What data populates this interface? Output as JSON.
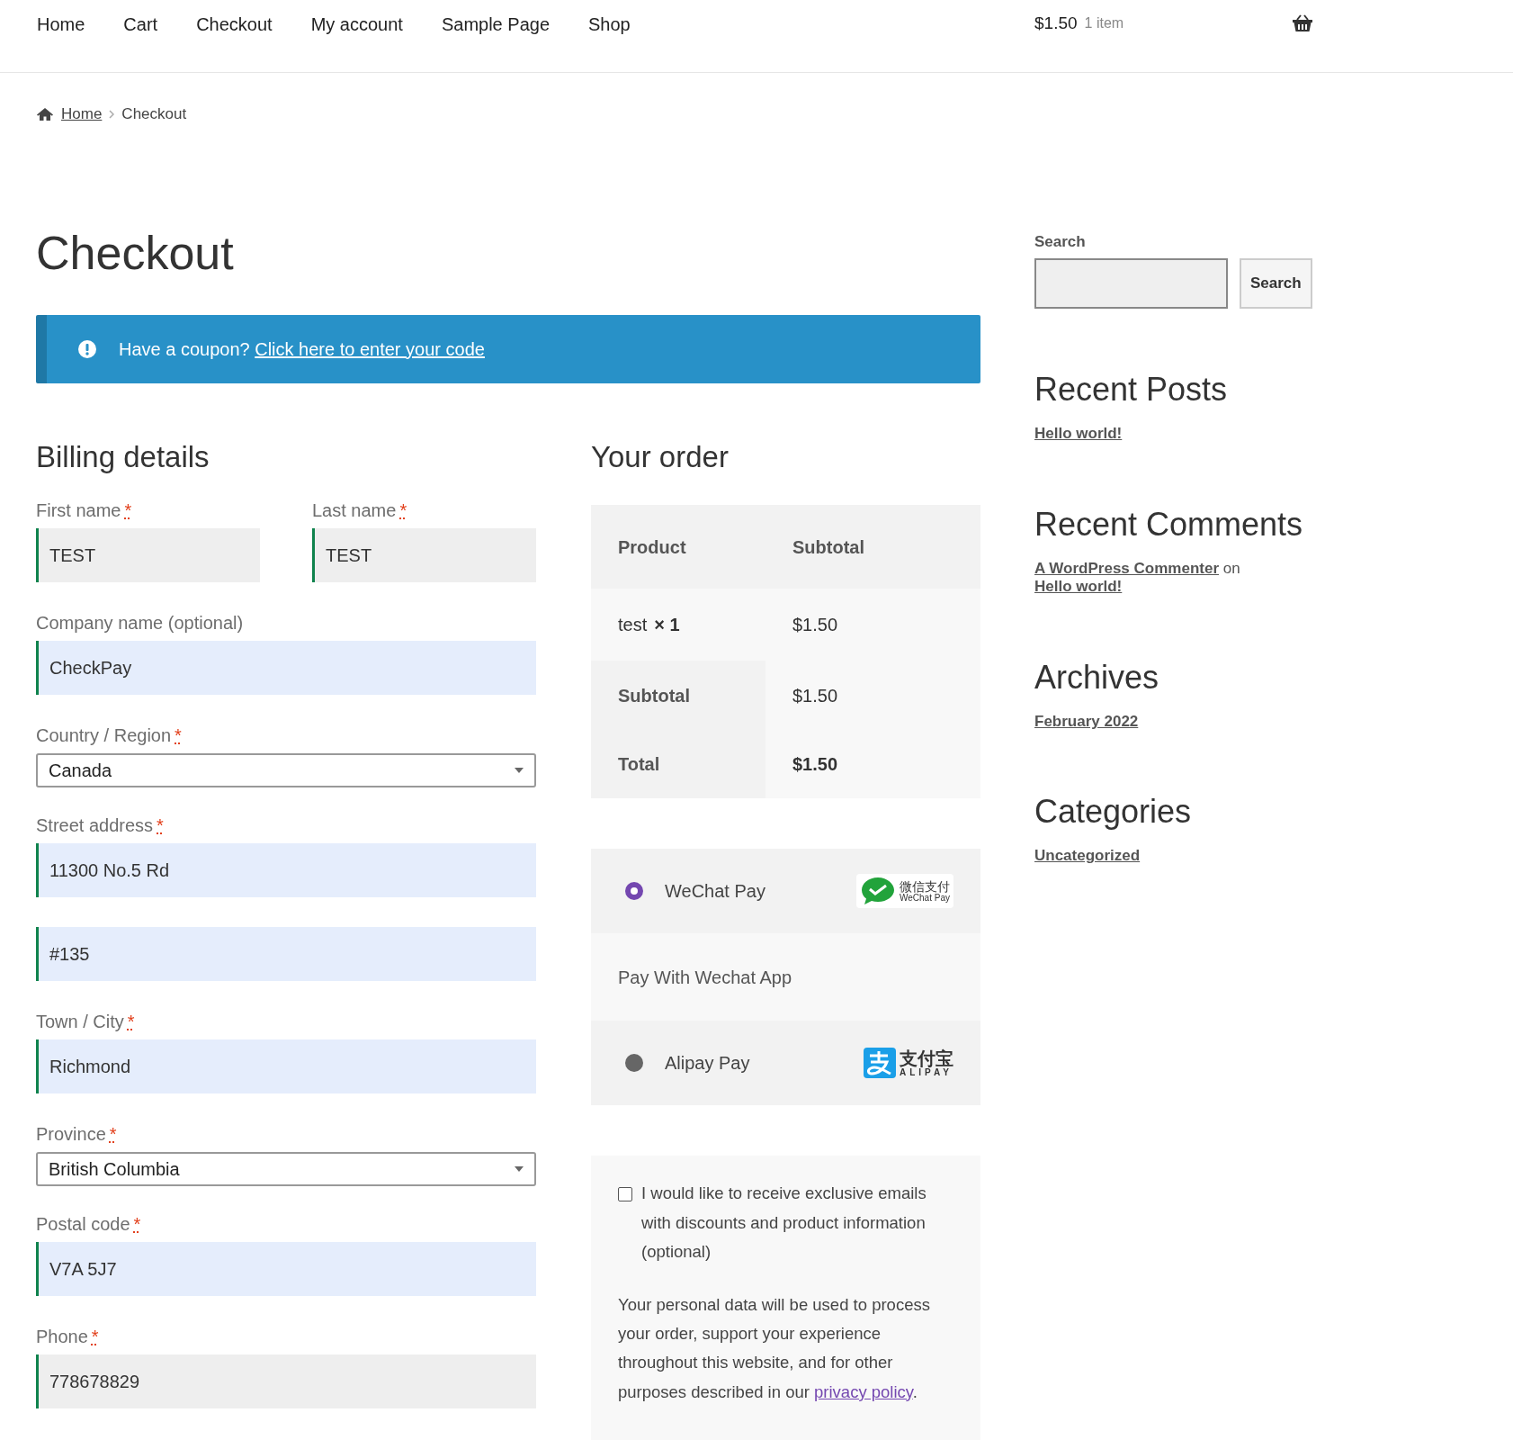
{
  "nav": {
    "items": [
      "Home",
      "Cart",
      "Checkout",
      "My account",
      "Sample Page",
      "Shop"
    ],
    "cart_total": "$1.50",
    "cart_count": "1 item"
  },
  "breadcrumb": [
    {
      "label": "Home",
      "link": true
    },
    {
      "label": "Checkout",
      "link": false
    }
  ],
  "page_title": "Checkout",
  "notice": {
    "text": "Have a coupon?",
    "link": "Click here to enter your code"
  },
  "billing": {
    "title": "Billing details",
    "fields": [
      {
        "kind": "pair",
        "fields": [
          {
            "kind": "input",
            "label": "First name",
            "required_mark": "*",
            "value": "TEST",
            "autofilled": false
          },
          {
            "kind": "input",
            "label": "Last name",
            "required_mark": "*",
            "value": "TEST",
            "autofilled": false
          }
        ]
      },
      {
        "kind": "input",
        "label": "Company name (optional)",
        "value": "CheckPay",
        "autofilled": true
      },
      {
        "kind": "select",
        "label": "Country / Region",
        "required_mark": "*",
        "value": "Canada"
      },
      {
        "kind": "input",
        "label": "Street address",
        "required_mark": "*",
        "value": "11300 No.5 Rd",
        "autofilled": true
      },
      {
        "kind": "input",
        "value": "#135",
        "autofilled": true
      },
      {
        "kind": "input",
        "label": "Town / City",
        "required_mark": "*",
        "value": "Richmond",
        "autofilled": true
      },
      {
        "kind": "select",
        "label": "Province",
        "required_mark": "*",
        "value": "British Columbia"
      },
      {
        "kind": "input",
        "label": "Postal code",
        "required_mark": "*",
        "value": "V7A 5J7",
        "autofilled": true
      },
      {
        "kind": "input",
        "label": "Phone",
        "required_mark": "*",
        "value": "778678829",
        "autofilled": false
      }
    ]
  },
  "order": {
    "title": "Your order",
    "columns": [
      "Product",
      "Subtotal"
    ],
    "items": [
      {
        "name": "test",
        "qty": "× 1",
        "subtotal": "$1.50"
      }
    ],
    "totals": [
      {
        "kind": "subtotal",
        "label": "Subtotal",
        "value": "$1.50"
      },
      {
        "kind": "total",
        "label": "Total",
        "value": "$1.50"
      }
    ]
  },
  "payments": [
    {
      "name": "WeChat Pay",
      "selected": true,
      "kind": "wechat",
      "logo_text": [
        "微信支付",
        "WeChat Pay"
      ],
      "description": "Pay With Wechat App"
    },
    {
      "name": "Alipay Pay",
      "selected": false,
      "kind": "alipay",
      "logo_text": [
        "支付宝",
        "ALIPAY"
      ]
    }
  ],
  "newsletter": {
    "checked": false,
    "label": "I would like to receive exclusive emails with discounts and product information (optional)"
  },
  "privacy": {
    "text": "Your personal data will be used to process your order, support your experience throughout this website, and for other purposes described in our",
    "link": "privacy policy",
    "after": "."
  },
  "sidebar": {
    "search": {
      "label": "Search",
      "button": "Search"
    },
    "widgets": [
      {
        "title": "Recent Posts",
        "lines": [
          [
            {
              "text": "Hello world!",
              "link": true
            }
          ]
        ]
      },
      {
        "title": "Recent Comments",
        "lines": [
          [
            {
              "text": "A WordPress Commenter",
              "link": true
            },
            {
              "text": "on",
              "link": false
            },
            {
              "text": "Hello world!",
              "link": true
            }
          ]
        ]
      },
      {
        "title": "Archives",
        "lines": [
          [
            {
              "text": "February 2022",
              "link": true
            }
          ]
        ]
      },
      {
        "title": "Categories",
        "lines": [
          [
            {
              "text": "Uncategorized",
              "link": true
            }
          ]
        ]
      }
    ]
  }
}
